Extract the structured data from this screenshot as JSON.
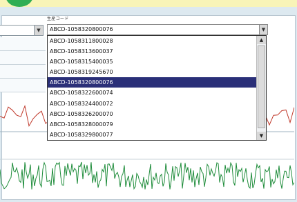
{
  "field": {
    "label": "生産コード",
    "selected_value": "ABCD-1058320800076"
  },
  "dropdown": {
    "items": [
      "ABCD-1058311800028",
      "ABCD-1058313600037",
      "ABCD-1058315400035",
      "ABCD-1058319245670",
      "ABCD-1058320800076",
      "ABCD-1058322600074",
      "ABCD-1058324400072",
      "ABCD-1058326200070",
      "ABCD-1058328000079",
      "ABCD-1058329800077"
    ],
    "selected_index": 4
  },
  "icons": {
    "combo_arrow": "chevron-down-icon",
    "scroll_up": "scroll-up-icon",
    "scroll_down": "scroll-down-icon"
  },
  "colors": {
    "banner": "#f8f4b8",
    "accent_green": "#2fae54",
    "selection": "#2a2f78",
    "red_series": "#c0392b",
    "green_series": "#1e8c3a"
  }
}
